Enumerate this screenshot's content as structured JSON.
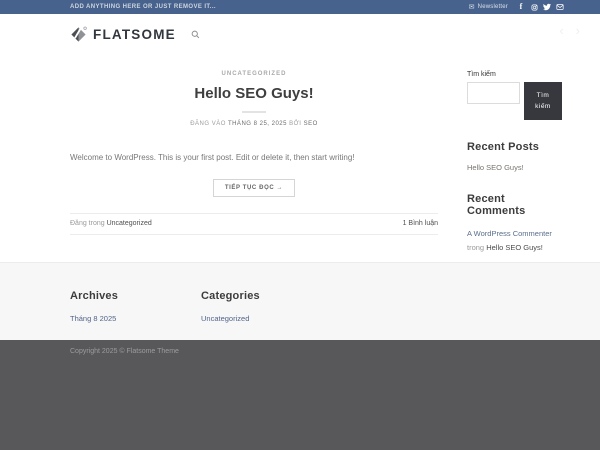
{
  "topbar": {
    "message": "ADD ANYTHING HERE OR JUST REMOVE IT...",
    "newsletter_label": "Newsletter",
    "icons": [
      "envelope-icon",
      "facebook-icon",
      "instagram-icon",
      "twitter-icon",
      "email-icon"
    ]
  },
  "header": {
    "logo_text": "FLATSOME",
    "prev_arrow": "‹",
    "next_arrow": "›"
  },
  "post": {
    "category": "UNCATEGORIZED",
    "title": "Hello SEO Guys!",
    "meta_prefix": "ĐĂNG VÀO",
    "meta_date": "THÁNG 8 25, 2025",
    "meta_by": "BỞI",
    "meta_author": "SEO",
    "excerpt": "Welcome to WordPress. This is your first post. Edit or delete it, then start writing!",
    "read_more_label": "TIẾP TỤC ĐỌC →",
    "posted_in_label": "Đăng trong",
    "category_link": "Uncategorized",
    "comments_link": "1 Bình luận"
  },
  "sidebar": {
    "search": {
      "label": "Tìm kiếm",
      "input_value": "",
      "button_label": "Tìm kiếm"
    },
    "recent_posts": {
      "title": "Recent Posts",
      "items": [
        "Hello SEO Guys!"
      ]
    },
    "recent_comments": {
      "title": "Recent Comments",
      "author": "A WordPress Commenter",
      "in_label": "trong",
      "post": "Hello SEO Guys!"
    }
  },
  "footer": {
    "archives": {
      "title": "Archives",
      "items": [
        "Tháng 8 2025"
      ]
    },
    "categories": {
      "title": "Categories",
      "items": [
        "Uncategorized"
      ]
    },
    "copyright": "Copyright 2025 © Flatsome Theme"
  },
  "colors": {
    "topbar_bg": "#47628c",
    "primary": "#446084",
    "dark_button": "#36383d",
    "dark_footer": "#58585a",
    "footer_bg": "#f7f7f7"
  }
}
